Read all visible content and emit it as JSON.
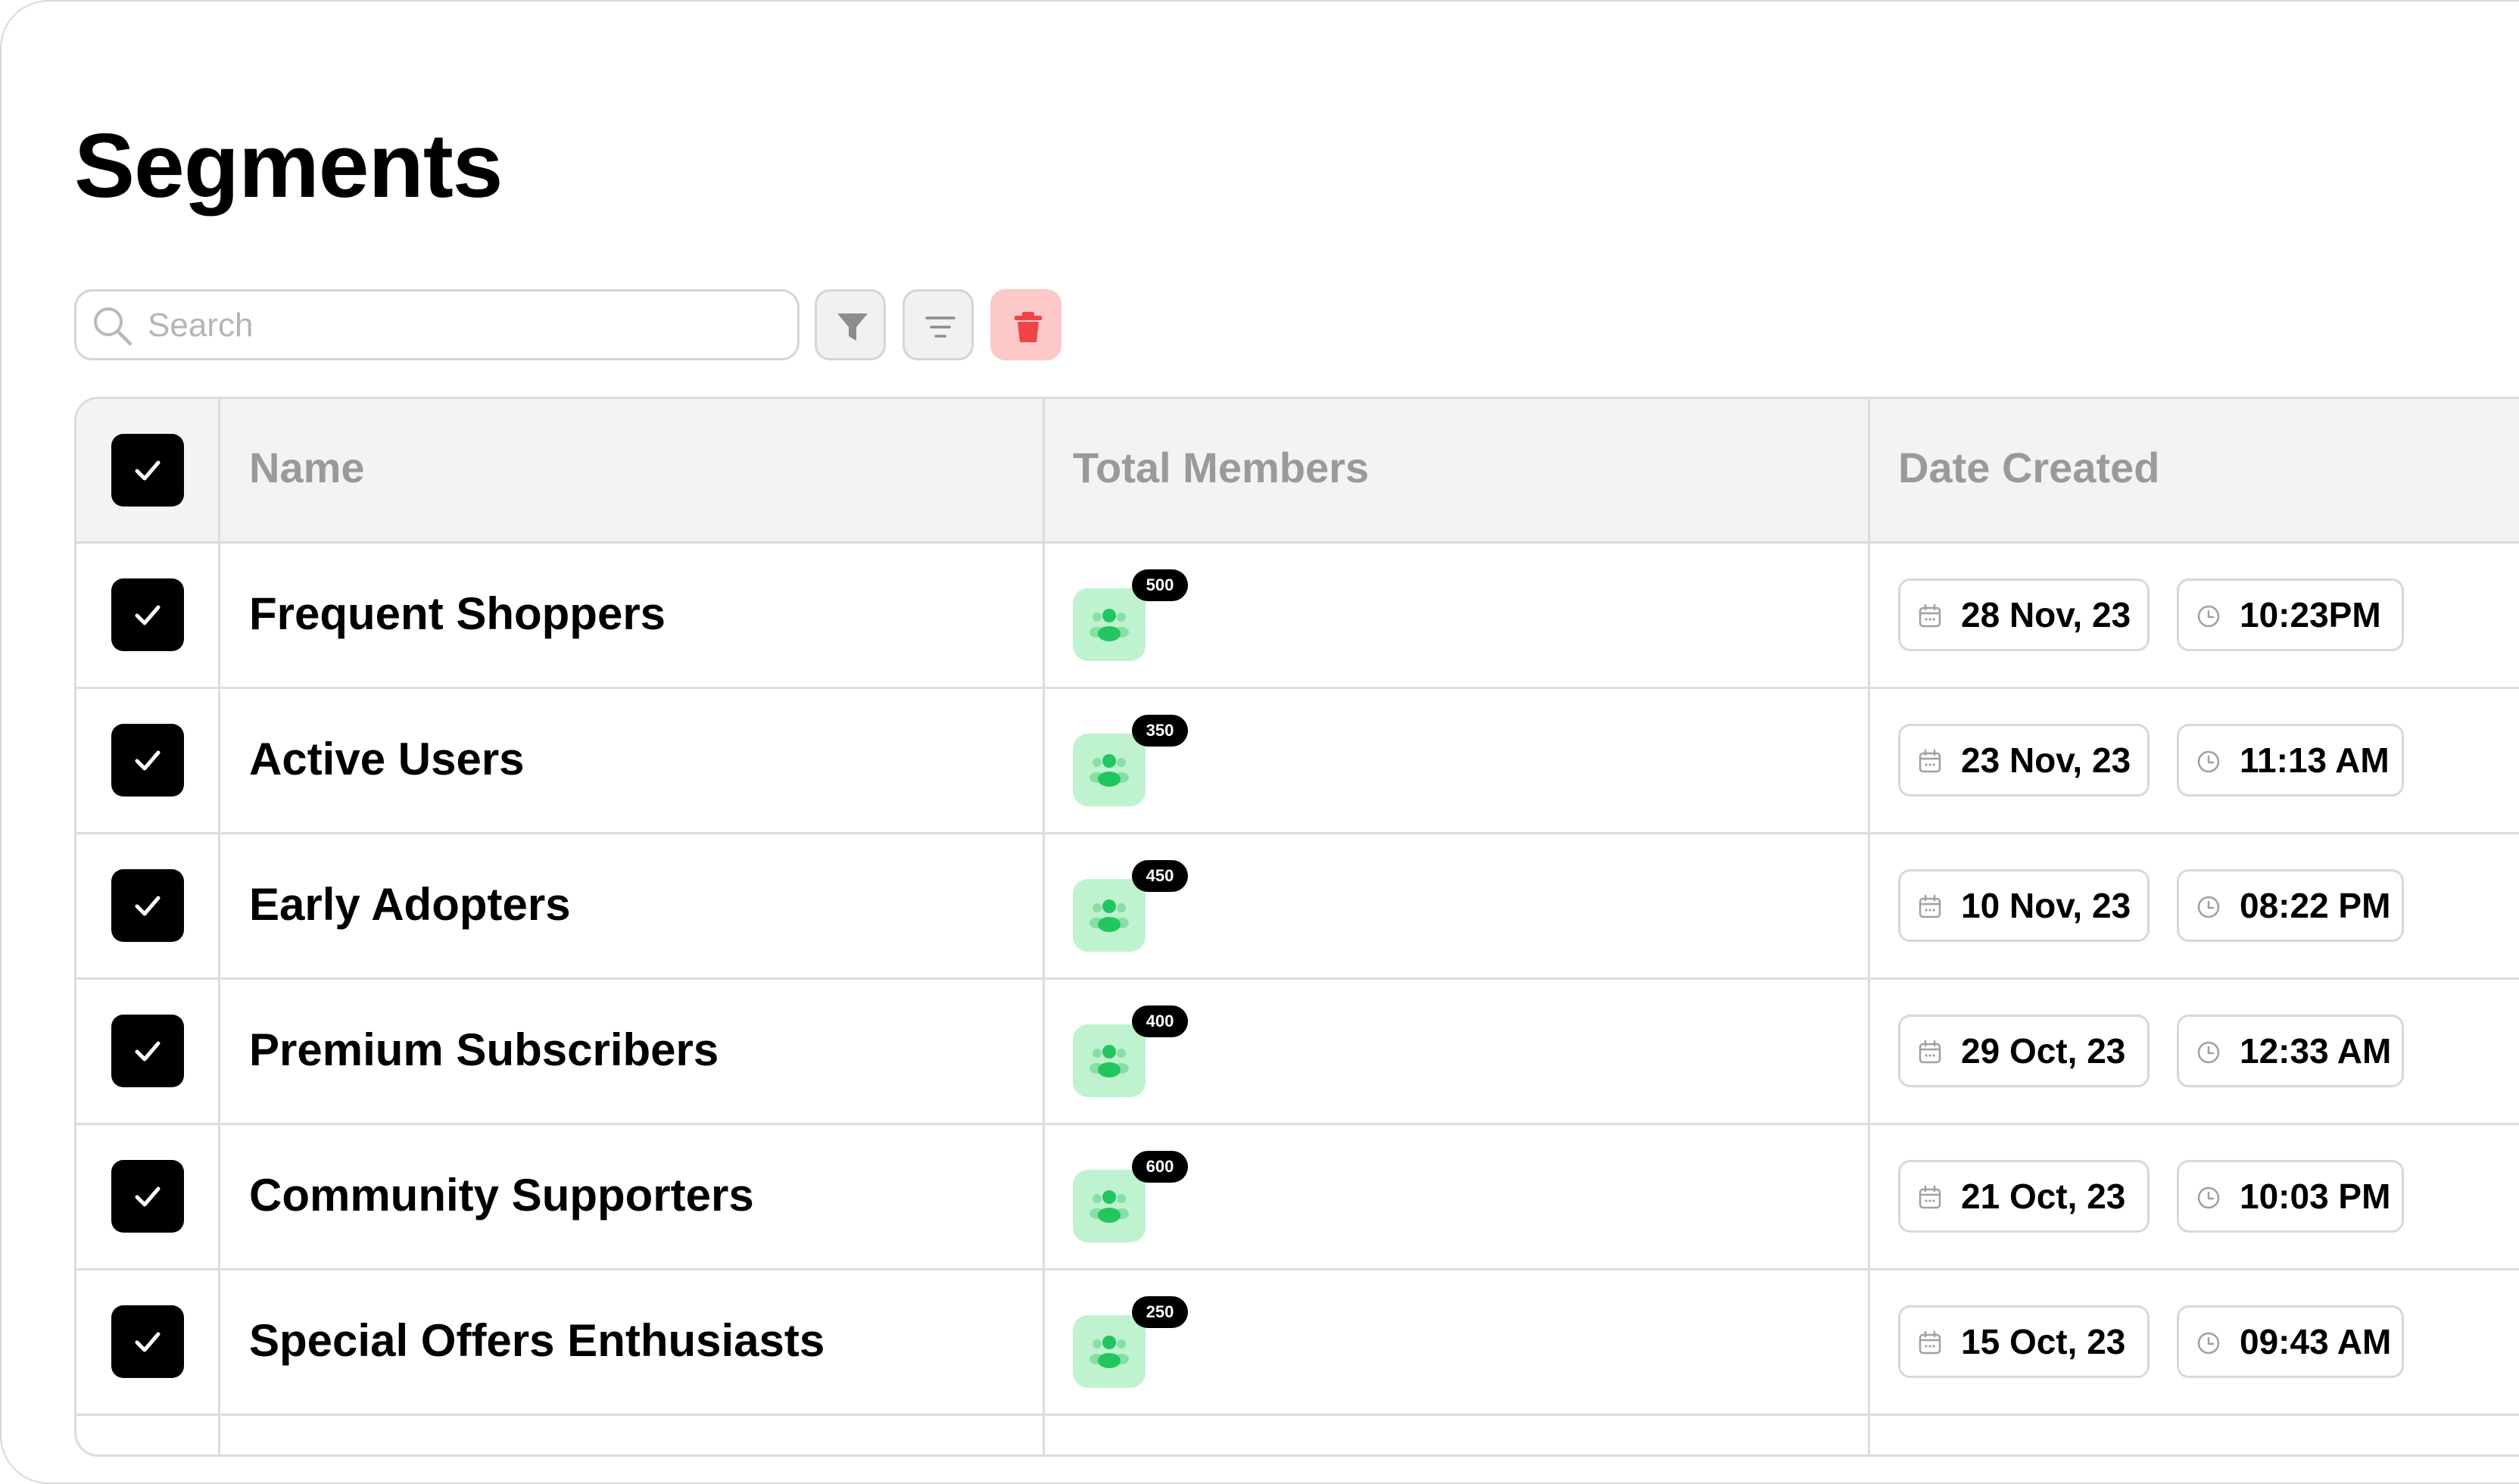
{
  "page": {
    "title": "Segments"
  },
  "toolbar": {
    "search_placeholder": "Search",
    "filter_icon": "funnel-icon",
    "sort_icon": "sort-lines-icon",
    "delete_icon": "trash-icon"
  },
  "table": {
    "columns": [
      "Name",
      "Total Members",
      "Date Created"
    ],
    "select_all_checked": true,
    "rows": [
      {
        "name": "Frequent Shoppers",
        "members": "500",
        "date": "28 Nov, 23",
        "time": "10:23PM",
        "checked": true
      },
      {
        "name": "Active Users",
        "members": "350",
        "date": "23 Nov, 23",
        "time": "11:13 AM",
        "checked": true
      },
      {
        "name": "Early Adopters",
        "members": "450",
        "date": "10 Nov, 23",
        "time": "08:22 PM",
        "checked": true
      },
      {
        "name": "Premium Subscribers",
        "members": "400",
        "date": "29 Oct, 23",
        "time": "12:33 AM",
        "checked": true
      },
      {
        "name": "Community Supporters",
        "members": "600",
        "date": "21 Oct, 23",
        "time": "10:03 PM",
        "checked": true
      },
      {
        "name": "Special Offers Enthusiasts",
        "members": "250",
        "date": "15 Oct, 23",
        "time": "09:43 AM",
        "checked": true
      }
    ]
  },
  "colors": {
    "member_icon_bg": "#bff2cf",
    "member_icon_fg": "#22c55e",
    "delete_bg": "#fcc8c8",
    "delete_fg": "#ef4444",
    "header_bg": "#f3f3f3",
    "header_text": "#9a9a9a"
  }
}
